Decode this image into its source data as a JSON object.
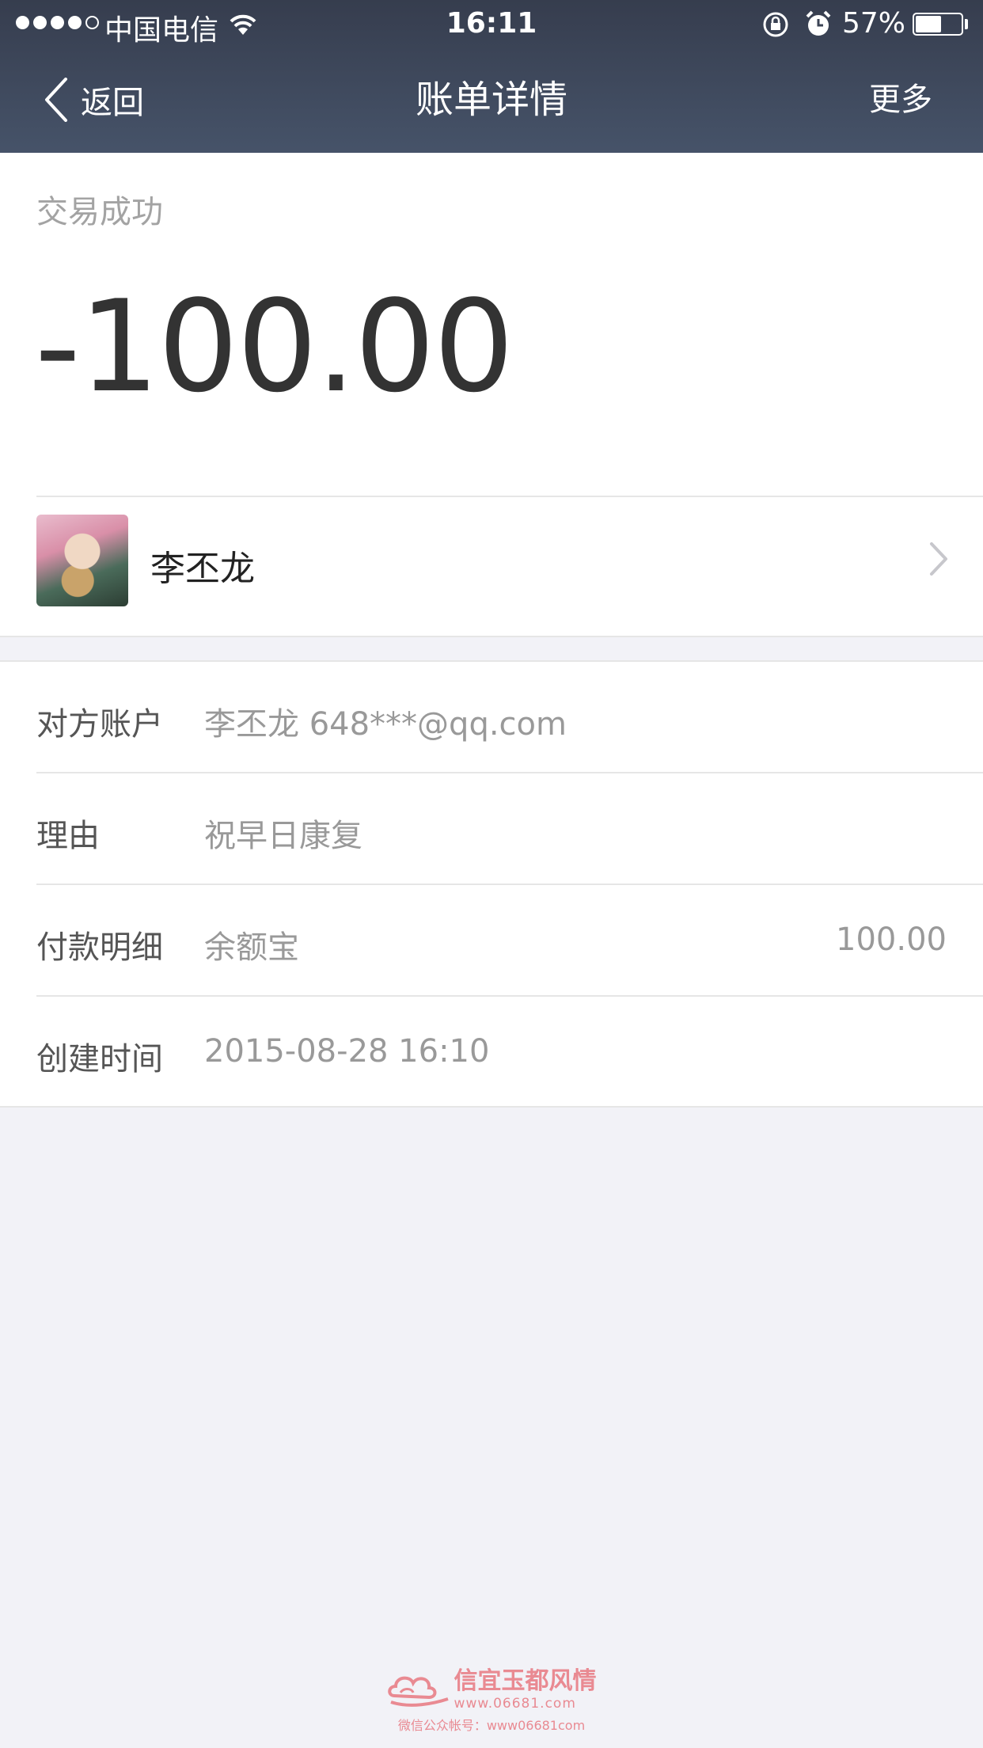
{
  "status_bar": {
    "carrier": "中国电信",
    "time": "16:11",
    "battery_percent": "57%",
    "battery_level": 0.57,
    "signal_dots": 4
  },
  "nav": {
    "back_label": "返回",
    "title": "账单详情",
    "more_label": "更多"
  },
  "summary": {
    "status": "交易成功",
    "amount": "-100.00",
    "payee_name": "李丕龙"
  },
  "details": [
    {
      "label": "对方账户",
      "value": "李丕龙 648***@qq.com",
      "amount": ""
    },
    {
      "label": "理由",
      "value": "祝早日康复",
      "amount": ""
    },
    {
      "label": "付款明细",
      "value": "余额宝",
      "amount": "100.00"
    },
    {
      "label": "创建时间",
      "value": "2015-08-28 16:10",
      "amount": ""
    }
  ],
  "watermark": {
    "title": "信宜玉都风情",
    "url": "www.06681.com",
    "subtitle": "微信公众帐号：www06681com"
  },
  "colors": {
    "nav_bg_top": "#363d4e",
    "nav_bg_bottom": "#465369",
    "page_bg": "#f2f2f7",
    "watermark": "#e98a92"
  },
  "icons": [
    "signal-dots",
    "wifi-icon",
    "rotation-lock-icon",
    "alarm-icon",
    "battery-icon",
    "back-chevron-icon",
    "chevron-right-icon",
    "cloud-logo-icon"
  ]
}
